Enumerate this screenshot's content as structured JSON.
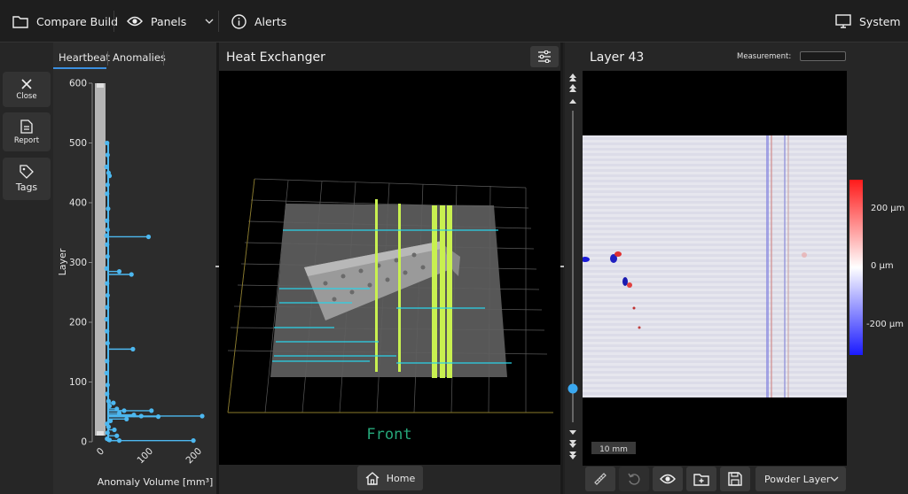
{
  "topbar": {
    "compare_label": "Compare Build",
    "panels_label": "Panels",
    "alerts_label": "Alerts",
    "system_label": "System"
  },
  "rail": {
    "close_label": "Close",
    "report_label": "Report",
    "tags_label": "Tags"
  },
  "chart_panel": {
    "tabs": [
      {
        "label": "Heartbeat",
        "active": true
      },
      {
        "label": "Anomalies",
        "active": false
      }
    ]
  },
  "chart_data": {
    "type": "scatter",
    "xlabel": "Anomaly Volume [mm³]",
    "ylabel": "Layer",
    "xlim": [
      0,
      200
    ],
    "ylim": [
      0,
      600
    ],
    "x_ticks": [
      "0",
      "100",
      "200"
    ],
    "y_ticks": [
      "0",
      "100",
      "200",
      "300",
      "400",
      "500",
      "600"
    ],
    "color": "#4db8f0",
    "points": [
      [
        5,
        500
      ],
      [
        6,
        480
      ],
      [
        4,
        460
      ],
      [
        8,
        450
      ],
      [
        10,
        445
      ],
      [
        6,
        430
      ],
      [
        5,
        415
      ],
      [
        7,
        390
      ],
      [
        5,
        370
      ],
      [
        6,
        355
      ],
      [
        4,
        345
      ],
      [
        90,
        343
      ],
      [
        5,
        330
      ],
      [
        6,
        310
      ],
      [
        4,
        290
      ],
      [
        30,
        285
      ],
      [
        55,
        280
      ],
      [
        5,
        265
      ],
      [
        6,
        245
      ],
      [
        5,
        225
      ],
      [
        4,
        205
      ],
      [
        5,
        185
      ],
      [
        6,
        165
      ],
      [
        58,
        155
      ],
      [
        5,
        135
      ],
      [
        4,
        115
      ],
      [
        6,
        95
      ],
      [
        5,
        80
      ],
      [
        8,
        68
      ],
      [
        18,
        65
      ],
      [
        10,
        60
      ],
      [
        25,
        55
      ],
      [
        40,
        52
      ],
      [
        96,
        52
      ],
      [
        30,
        48
      ],
      [
        60,
        45
      ],
      [
        75,
        43
      ],
      [
        110,
        42
      ],
      [
        200,
        43
      ],
      [
        45,
        38
      ],
      [
        12,
        35
      ],
      [
        5,
        30
      ],
      [
        8,
        25
      ],
      [
        20,
        20
      ],
      [
        6,
        15
      ],
      [
        25,
        10
      ],
      [
        5,
        5
      ],
      [
        10,
        3
      ],
      [
        30,
        2
      ],
      [
        182,
        2
      ]
    ],
    "scrollbar_range": [
      0,
      600
    ]
  },
  "center": {
    "title": "Heat Exchanger",
    "view_label": "Front",
    "home_label": "Home"
  },
  "right": {
    "title": "Layer 43",
    "measurement_label": "Measurement:",
    "measurement_value": "",
    "scale_bar_label": "10 mm",
    "powder_layer_label": "Powder Layer",
    "colorbar_labels": [
      "200 µm",
      "0 µm",
      "-200 µm"
    ],
    "colorbar_colors": [
      "#ff1a1a",
      "#ffffff",
      "#1a1aff"
    ],
    "layer_slider_value": 0.1
  },
  "icons": {
    "folder": "folder-icon",
    "eye": "eye-icon",
    "chevron": "chevron-down-icon",
    "info": "info-icon",
    "monitor": "monitor-icon",
    "close": "close-icon",
    "report": "report-icon",
    "tag": "tag-icon",
    "settings": "sliders-icon",
    "home": "home-icon",
    "ruler": "ruler-icon",
    "undo": "undo-icon",
    "add-folder": "add-folder-icon",
    "save": "save-icon"
  }
}
